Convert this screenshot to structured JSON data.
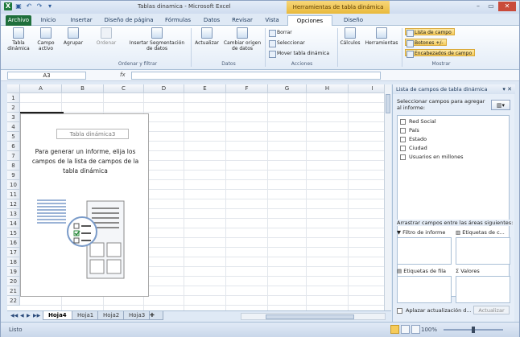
{
  "window": {
    "title": "Tablas dinamica - Microsoft Excel",
    "context_title": "Herramientas de tabla dinámica"
  },
  "tabs": [
    "Archivo",
    "Inicio",
    "Insertar",
    "Diseño de página",
    "Fórmulas",
    "Datos",
    "Revisar",
    "Vista",
    "Opciones",
    "Diseño"
  ],
  "ribbon": {
    "tabla_dinamica": "Tabla dinámica",
    "campo_activo": "Campo activo",
    "agrupar": "Agrupar",
    "ordenar": "Ordenar",
    "insertar_segmentacion": "Insertar Segmentación de datos",
    "actualizar": "Actualizar",
    "cambiar_origen": "Cambiar origen de datos",
    "borrar": "Borrar",
    "seleccionar": "Seleccionar",
    "mover": "Mover tabla dinámica",
    "calculos": "Cálculos",
    "herramientas": "Herramientas",
    "lista_campo": "Lista de campo",
    "botones": "Botones +/-",
    "encabezados": "Encabezados de campo",
    "group_ordenar": "Ordenar y filtrar",
    "group_datos": "Datos",
    "group_acciones": "Acciones",
    "group_mostrar": "Mostrar"
  },
  "formula_bar": {
    "cell_ref": "A3",
    "fx": "fx",
    "value": ""
  },
  "grid": {
    "columns": [
      "A",
      "B",
      "C",
      "D",
      "E",
      "F",
      "G",
      "H",
      "I"
    ],
    "rows": [
      "1",
      "2",
      "3",
      "4",
      "5",
      "6",
      "7",
      "8",
      "9",
      "10",
      "11",
      "12",
      "13",
      "14",
      "15",
      "16",
      "17",
      "18",
      "19",
      "20",
      "21",
      "22"
    ]
  },
  "pivot_placeholder": {
    "title": "Tabla dinámica3",
    "message": "Para generar un informe, elija los campos de la lista de campos de la tabla dinámica"
  },
  "sheet_tabs": [
    "Hoja4",
    "Hoja1",
    "Hoja2",
    "Hoja3"
  ],
  "status": {
    "ready": "Listo",
    "zoom": "100%",
    "zoom_fraction": 0.5
  },
  "field_panel": {
    "title": "Lista de campos de tabla dinámica",
    "instruction": "Seleccionar campos para agregar al informe:",
    "fields": [
      "Red Social",
      "País",
      "Estado",
      "Ciudad",
      "Usuarios en millones"
    ],
    "drag_hint": "Arrastrar campos entre las áreas siguientes:",
    "areas": {
      "filtro": "Filtro de informe",
      "columnas": "Etiquetas de c...",
      "filas": "Etiquetas de fila",
      "valores": "Valores"
    },
    "defer": "Aplazar actualización d...",
    "update": "Actualizar"
  },
  "colors": {
    "file_tab": "#1f6f3b",
    "context_tab": "#e9b93b",
    "highlight": "#f6cb5a"
  }
}
